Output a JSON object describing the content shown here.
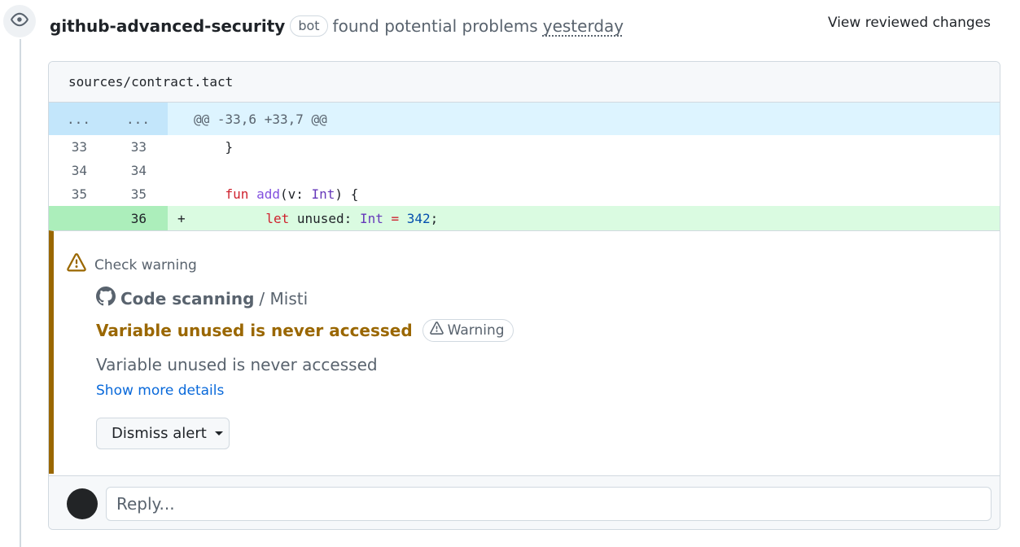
{
  "review": {
    "author": "github-advanced-security",
    "bot_badge": "bot",
    "action_text": "found potential problems",
    "time": "yesterday",
    "view_changes_label": "View reviewed changes"
  },
  "file": {
    "path": "sources/contract.tact",
    "hunk": {
      "old_marker": "...",
      "new_marker": "...",
      "header": "@@ -33,6 +33,7 @@"
    },
    "lines": [
      {
        "old": "33",
        "new": "33",
        "text": "}"
      },
      {
        "old": "34",
        "new": "34",
        "text": ""
      },
      {
        "old": "35",
        "new": "35",
        "text": "fun add(v: Int) {"
      },
      {
        "old": "",
        "new": "36",
        "marker": "+",
        "text": "let unused: Int = 342;"
      }
    ]
  },
  "alert": {
    "check_label": "Check warning",
    "scanner_name": "Code scanning",
    "scanner_tool": "/ Misti",
    "title": "Variable unused is never accessed",
    "severity": "Warning",
    "description": "Variable unused is never accessed",
    "show_more_label": "Show more details",
    "dismiss_label": "Dismiss alert"
  },
  "reply": {
    "placeholder": "Reply..."
  },
  "colors": {
    "warning_accent": "#9a6700",
    "link": "#0969da",
    "added_line_bg": "#dafbe1",
    "hunk_bg": "#ddf4ff"
  },
  "icons": [
    "eye-icon",
    "alert-triangle-icon",
    "github-mark-icon",
    "triangle-down-icon"
  ]
}
